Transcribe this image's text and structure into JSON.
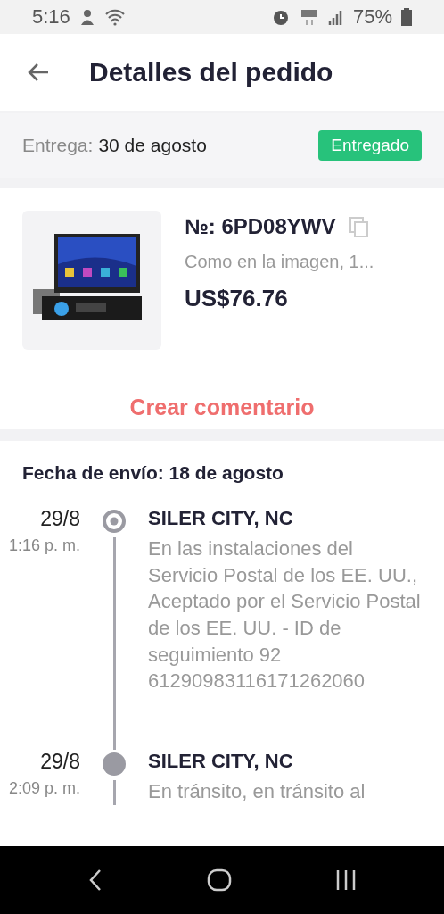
{
  "status_bar": {
    "time": "5:16",
    "battery": "75%"
  },
  "header": {
    "title": "Detalles del pedido"
  },
  "delivery": {
    "label": "Entrega:",
    "date": "30 de agosto",
    "status": "Entregado"
  },
  "order": {
    "number": "№: 6PD08YWV",
    "variant": "Como en la imagen, 1...",
    "price": "US$76.76",
    "action": "Crear comentario"
  },
  "shipping": {
    "title": "Fecha de envío: 18 de agosto",
    "events": [
      {
        "date": "29/8",
        "time": "1:16 p. m.",
        "place": "SILER CITY, NC",
        "description": "En las instalaciones del Servicio Postal de los EE. UU., Aceptado por el Servicio Postal de los EE. UU. - ID de seguimiento 92 61290983116171262060",
        "current": true
      },
      {
        "date": "29/8",
        "time": "2:09 p. m.",
        "place": "SILER CITY, NC",
        "description": "En tránsito, en tránsito al",
        "current": false
      }
    ]
  }
}
